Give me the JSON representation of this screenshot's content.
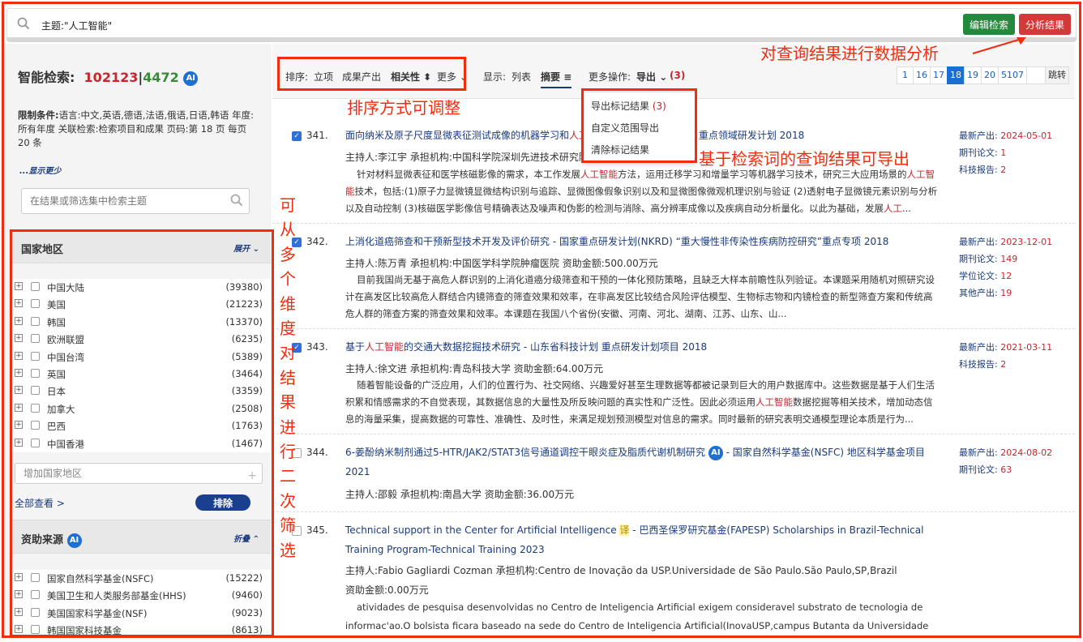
{
  "search": {
    "query": "主题:\"人工智能\"",
    "edit_label": "编辑检索",
    "analyze_label": "分析结果"
  },
  "sidebar": {
    "title": "智能检索:",
    "count_total": "102123",
    "separator": "|",
    "count_ai": "4472",
    "ai_label": "AI",
    "limits_label": "限制条件:",
    "limits_text": "语言:中文,英语,德语,法语,俄语,日语,韩语 年度:所有年度 关联检索:检索项目和成果 页码:第 18 页 每页 20 条",
    "show_less": "...显示更少",
    "filter_placeholder": "在结果或筛选集中检索主题",
    "region": {
      "title": "国家地区",
      "toggle": "展开",
      "items": [
        {
          "name": "中国大陆",
          "count": "(39380)"
        },
        {
          "name": "美国",
          "count": "(21223)"
        },
        {
          "name": "韩国",
          "count": "(13370)"
        },
        {
          "name": "欧洲联盟",
          "count": "(6235)"
        },
        {
          "name": "中国台湾",
          "count": "(5389)"
        },
        {
          "name": "英国",
          "count": "(3464)"
        },
        {
          "name": "日本",
          "count": "(3359)"
        },
        {
          "name": "加拿大",
          "count": "(2508)"
        },
        {
          "name": "巴西",
          "count": "(1763)"
        },
        {
          "name": "中国香港",
          "count": "(1467)"
        }
      ],
      "add_placeholder": "增加国家地区",
      "view_all": "全部查看 >",
      "exclude": "排除"
    },
    "funding": {
      "title": "资助来源",
      "toggle": "折叠",
      "items": [
        {
          "name": "国家自然科学基金(NSFC)",
          "count": "(15222)"
        },
        {
          "name": "美国卫生和人类服务部基金(HHS)",
          "count": "(9460)"
        },
        {
          "name": "美国国家科学基金(NSF)",
          "count": "(9023)"
        },
        {
          "name": "韩国国家科技基金",
          "count": "(8613)"
        }
      ]
    }
  },
  "toolbar": {
    "sort_label": "排序:",
    "sort_project": "立项",
    "sort_output": "成果产出",
    "sort_relevance": "相关性 ⬍",
    "sort_more": "更多",
    "display_label": "显示:",
    "display_list": "列表",
    "display_abstract": "摘要",
    "more_ops_label": "更多操作:",
    "export_label": "导出",
    "export_count": "(3)",
    "pages": [
      "1",
      "16",
      "17",
      "18",
      "19",
      "20",
      "5107",
      "",
      "跳转"
    ],
    "current_page": "18"
  },
  "export_menu": {
    "export_marked": "导出标记结果",
    "export_marked_count": "(3)",
    "custom_range": "自定义范围导出",
    "clear_marked": "清除标记结果"
  },
  "results": [
    {
      "index": "341.",
      "title_a": "面向纳米及原子尺度显微表征测试成像的机器学习和",
      "title_hl": "人工",
      "title_b": "智能",
      "title_c": "划 重点领域研发计划 2018",
      "meta": "主持人:李江宇 承担机构:中国科学院深圳先进技术研究院",
      "abstract_a": "针对材料显微表征和医学核磁影像的需求，本工作发展",
      "abstract_hl": "人工智能",
      "abstract_b": "方法，运用迁移学习和增量学习等机器学习技术，研究三大应用场景的",
      "abstract_hl2": "人工智能",
      "abstract_c": "技术，包括:(1)原子力显微镜显微结构识别与追踪、显微图像假象识别以及和显微图像微观机理识别与验证 (2)透射电子显微镜元素识别与分析以及自动控制 (3)核磁医学影像信号精确表达及噪声和伪影的检测与消除、高分辨率成像以及疾病自动分析量化。以此为基础，发展",
      "abstract_hl3": "人工",
      "abstract_d": "...",
      "stats": [
        {
          "label": "最新产出:",
          "value": "2024-05-01"
        },
        {
          "label": "期刊论文:",
          "value": "1"
        },
        {
          "label": "科技报告:",
          "value": "2"
        }
      ]
    },
    {
      "index": "342.",
      "title": "上消化道癌筛查和干预新型技术开发及评价研究   -   国家重点研发计划(NKRD) “重大慢性非传染性疾病防控研究”重点专项 2018",
      "meta": "主持人:陈万青 承担机构:中国医学科学院肿瘤医院 资助金额:500.00万元",
      "abstract": "目前我国尚无基于高危人群识别的上消化道癌分级筛查和干预的一体化预防策略，且缺乏大样本前瞻性队列验证。本课题采用随机对照研究设计在高发区比较高危人群结合内镜筛查的筛查效果和效率，在非高发区比较结合风险评估模型、生物标志物和内镜检查的新型筛查方案和传统高危人群的筛查方案的筛查效果和效率。本课题在我国八个省份(安徽、河南、河北、湖南、江苏、山东、山...",
      "stats": [
        {
          "label": "最新产出:",
          "value": "2023-12-01"
        },
        {
          "label": "期刊论文:",
          "value": "149"
        },
        {
          "label": "学位论文:",
          "value": "12"
        },
        {
          "label": "其他产出:",
          "value": "19"
        }
      ]
    },
    {
      "index": "343.",
      "title_a": "基于",
      "title_hl": "人工智能",
      "title_b": "的交通大数据挖掘技术研究   -   山东省科技计划 重点研发计划项目 2018",
      "meta": "主持人:徐文进 承担机构:青岛科技大学 资助金额:64.00万元",
      "abstract_a": "随着智能设备的广泛应用，人们的位置行为、社交网络、兴趣爱好甚至生理数据等都被记录到巨大的用户数据库中。这些数据是基于人们生活积累和情感需求的不自觉表现，其数据信息的大量性及所反映问题的真实性和广泛性。因此必须运用",
      "abstract_hl": "人工智能",
      "abstract_b": "数据挖掘等相关技术，增加动态信息的海量采集，提高数据的可靠性、准确性、及时性，来满足规划预测模型对信息的需求。同时最新的研究表明交通模型理论本质是行为...",
      "stats": [
        {
          "label": "最新产出:",
          "value": "2021-03-11"
        },
        {
          "label": "科技报告:",
          "value": "2"
        }
      ]
    },
    {
      "index": "344.",
      "title_a": "6-姜酚纳米制剂通过5-HTR/JAK2/STAT3信号通道调控干眼炎症及脂质代谢机制研究",
      "title_b": "   -   国家自然科学基金(NSFC) 地区科学基金项目 2021",
      "meta": "主持人:邵毅 承担机构:南昌大学 资助金额:36.00万元",
      "stats": [
        {
          "label": "最新产出:",
          "value": "2024-08-02"
        },
        {
          "label": "期刊论文:",
          "value": "63"
        }
      ]
    },
    {
      "index": "345.",
      "title_a": "Technical support in the Center for Artificial Intelligence",
      "translate": "译",
      "title_b": "   -   巴西圣保罗研究基金(FAPESP) Scholarships in Brazil-Technical Training Program-Technical Training 2023",
      "meta": "主持人:Fabio Gagliardi Cozman 承担机构:Centro de Inovação da USP.Universidade de São Paulo.São Paulo,SP,Brazil",
      "meta2": "资助金额:0.00万元",
      "abstract": "atividades de pesquisa desenvolvidas no Centro de Inteligencia Artificial exigem consideravel substrato de tecnologia de informac'ao.O bolsista ficara baseado na sede do Centro de Inteligencia Artificial(InovaUSP,campus Butanta da Universidade de Sao P"
    }
  ],
  "annotations": {
    "analyze": "对查询结果进行数据分析",
    "sort": "排序方式可调整",
    "export": "基于检索词的查询结果可导出",
    "filter_chars": [
      "可",
      "从",
      "多",
      "个",
      "维",
      "度",
      "对",
      "结",
      "果",
      "进",
      "行",
      "二",
      "次",
      "筛",
      "选"
    ]
  },
  "colors": {
    "annotation": "#f02d0f",
    "primary": "#1a3a7c",
    "highlight": "#c4262e",
    "edit_button": "#238a3d",
    "analyze_button": "#d23a3a"
  }
}
